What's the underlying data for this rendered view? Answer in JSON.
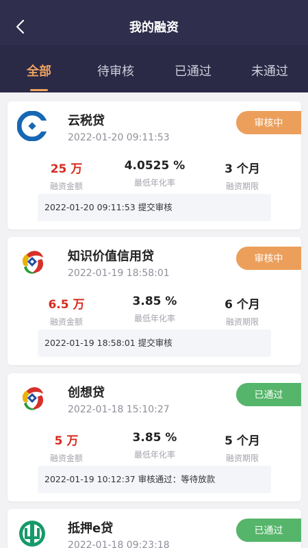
{
  "header": {
    "title": "我的融资",
    "back_icon": "back-arrow-icon"
  },
  "tabs": [
    {
      "label": "全部",
      "active": true
    },
    {
      "label": "待审核"
    },
    {
      "label": "已通过"
    },
    {
      "label": "未通过"
    }
  ],
  "colors": {
    "header_bg": "#2f2e4c",
    "accent": "#f0a35e",
    "pending": "#ec9f5b",
    "passed": "#55b56a",
    "amount_red": "#d62b1f"
  },
  "loans": [
    {
      "name": "云税贷",
      "date": "2022-01-20 09:11:53",
      "status": "审核中",
      "bank_logo": "ccb-logo-icon",
      "amount": "25 万",
      "amount_label": "融资金额",
      "rate": "4.0525 %",
      "rate_label": "最低年化率",
      "term": "3 个月",
      "term_label": "融资期限",
      "note": "2022-01-20 09:11:53 提交审核"
    },
    {
      "name": "知识价值信用贷",
      "date": "2022-01-19 18:58:01",
      "status": "审核中",
      "bank_logo": "flower-bank-logo-icon",
      "amount": "6.5 万",
      "amount_label": "融资金额",
      "rate": "3.85 %",
      "rate_label": "最低年化率",
      "term": "6 个月",
      "term_label": "融资期限",
      "note": "2022-01-19 18:58:01 提交审核"
    },
    {
      "name": "创想贷",
      "date": "2022-01-18 15:10:27",
      "status": "已通过",
      "bank_logo": "flower-bank-logo-icon",
      "amount": "5 万",
      "amount_label": "融资金额",
      "rate": "3.85 %",
      "rate_label": "最低年化率",
      "term": "5 个月",
      "term_label": "融资期限",
      "note": "2022-01-19 10:12:37 审核通过：等待放款"
    },
    {
      "name": "抵押e贷",
      "date": "2022-01-18 09:23:18",
      "status": "已通过",
      "bank_logo": "abc-logo-icon"
    }
  ]
}
